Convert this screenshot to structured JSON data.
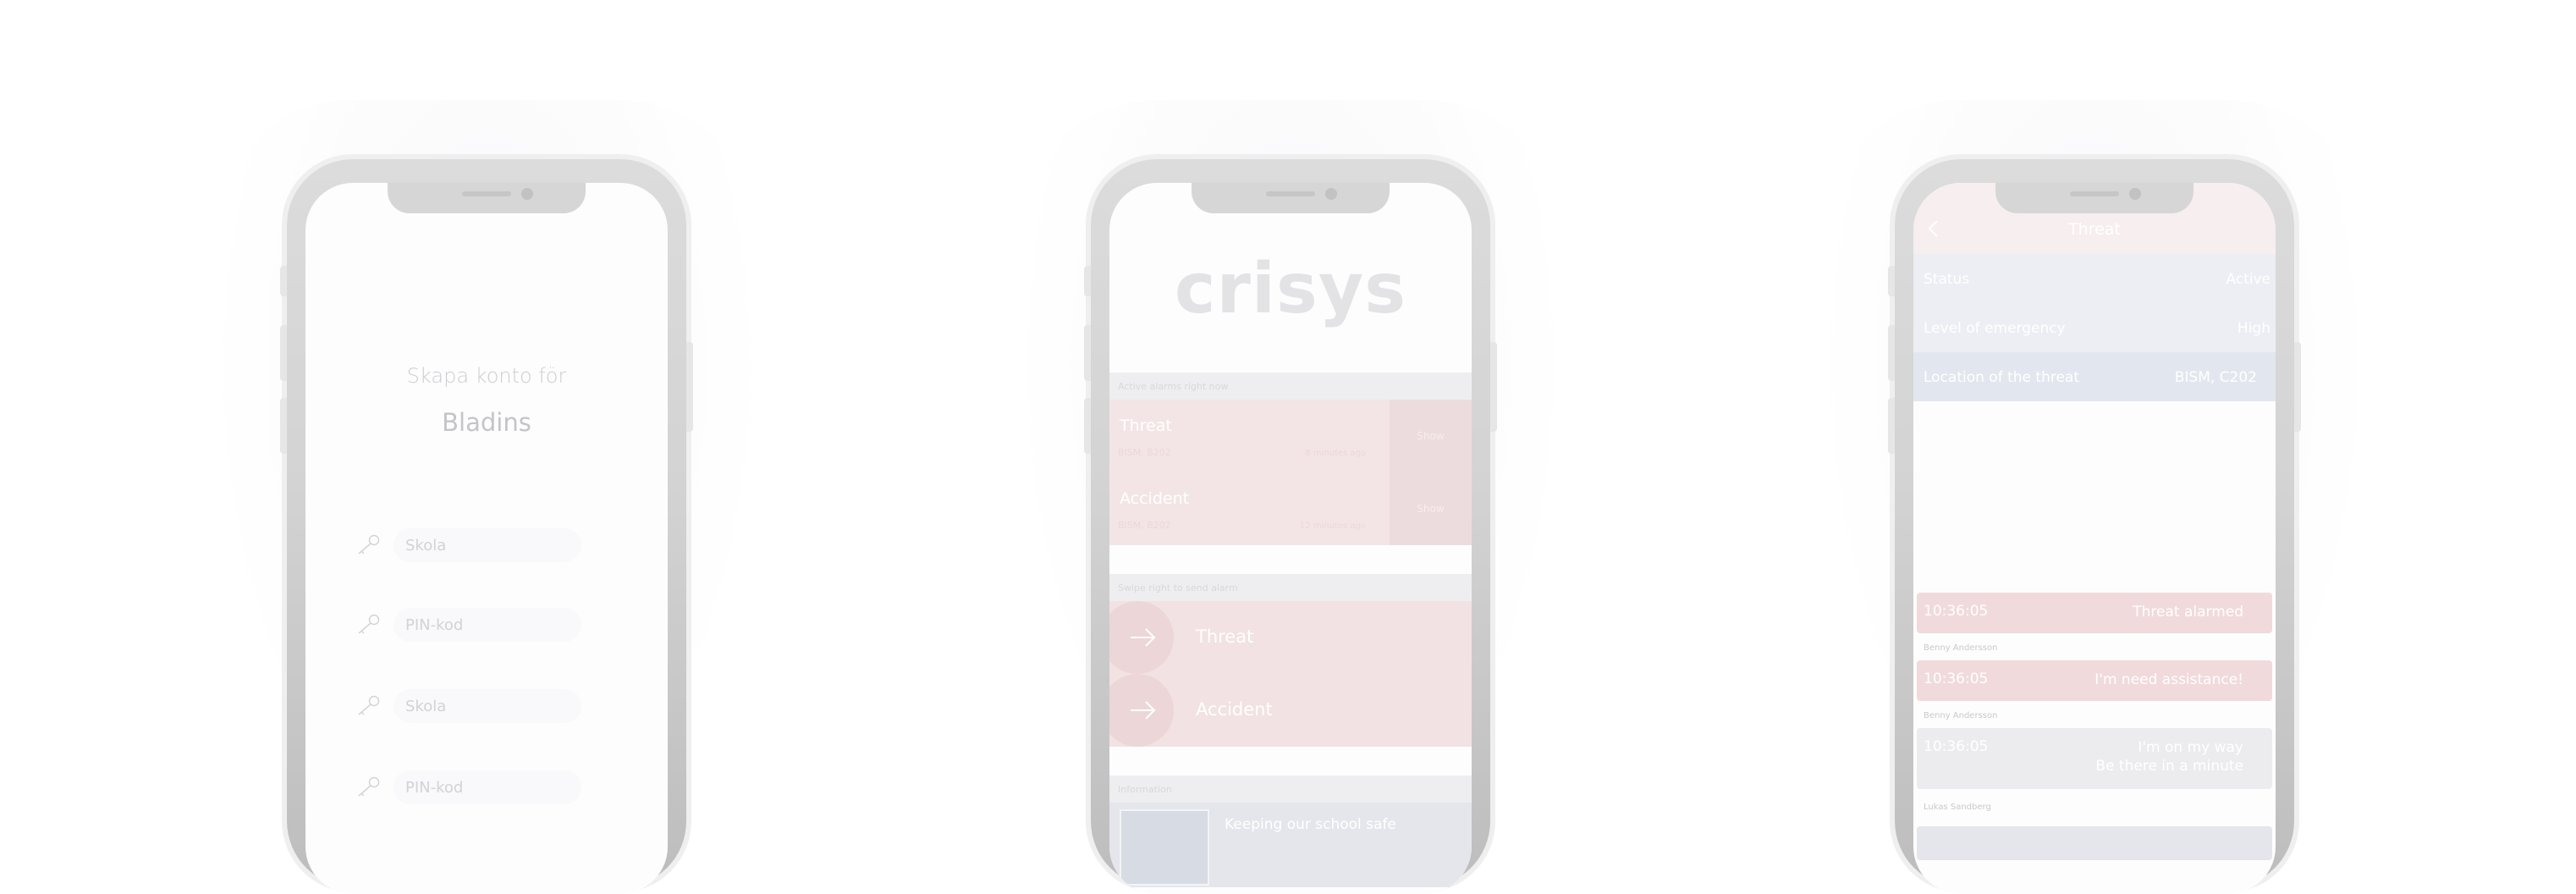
{
  "signup_screen": {
    "title": "Skapa konto för",
    "school_name": "Bladins",
    "fields": [
      {
        "icon": "key-icon",
        "placeholder": "Skola"
      },
      {
        "icon": "key-icon",
        "placeholder": "PIN-kod"
      },
      {
        "icon": "key-icon",
        "placeholder": "Skola"
      },
      {
        "icon": "key-icon",
        "placeholder": "PIN-kod"
      }
    ]
  },
  "home_screen": {
    "logo": "crisys",
    "ongoing_header": "Active alarms right now",
    "ongoing": [
      {
        "name": "Threat",
        "code": "BISM, B202",
        "ago": "8 minutes ago",
        "action": "Show"
      },
      {
        "name": "Accident",
        "code": "BISM, B202",
        "ago": "12 minutes ago",
        "action": "Show"
      }
    ],
    "alarm_header": "Swipe right to send alarm",
    "alarms": [
      {
        "name": "Threat",
        "icon": "arrow-right-icon"
      },
      {
        "name": "Accident",
        "icon": "arrow-right-icon"
      }
    ],
    "info_header": "Information",
    "info_title": "Keeping our school safe"
  },
  "detail_screen": {
    "title": "Threat",
    "details": [
      {
        "label": "Status",
        "value": "Active"
      },
      {
        "label": "Level of emergency",
        "value": "High"
      },
      {
        "label": "Location of the threat",
        "value": "BISM, C202"
      }
    ],
    "messages": [
      {
        "time": "10:36:05",
        "text": "Threat alarmed",
        "author": "Benny Andersson"
      },
      {
        "time": "10:36:05",
        "text": "I'm need assistance!",
        "author": "Benny Andersson"
      },
      {
        "time": "10:36:05",
        "text": "I'm on my way",
        "text2": "Be there in a minute",
        "author": "Lukas Sandberg"
      }
    ]
  },
  "colors": {
    "frame": "#d3d3d3",
    "alert_pink": "#f2e2e3",
    "info_blue": "#e4e6eb",
    "text_light": "#cdcdd2"
  }
}
